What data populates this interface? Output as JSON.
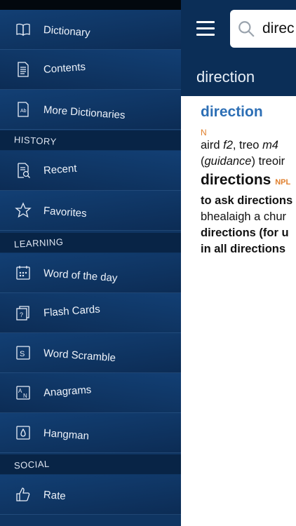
{
  "sidebar": {
    "items": [
      {
        "label": "Dictionary",
        "icon": "book-icon"
      },
      {
        "label": "Contents",
        "icon": "document-icon"
      },
      {
        "label": "More Dictionaries",
        "icon": "dictionaries-icon"
      }
    ],
    "history_header": "HISTORY",
    "history": [
      {
        "label": "Recent",
        "icon": "recent-icon"
      },
      {
        "label": "Favorites",
        "icon": "star-icon"
      }
    ],
    "learning_header": "LEARNING",
    "learning": [
      {
        "label": "Word of the day",
        "icon": "calendar-icon"
      },
      {
        "label": "Flash Cards",
        "icon": "flash-cards-icon"
      },
      {
        "label": "Word Scramble",
        "icon": "scramble-icon"
      },
      {
        "label": "Anagrams",
        "icon": "anagrams-icon"
      },
      {
        "label": "Hangman",
        "icon": "hangman-icon"
      }
    ],
    "social_header": "SOCIAL",
    "social": [
      {
        "label": "Rate",
        "icon": "thumbs-up-icon"
      }
    ]
  },
  "search": {
    "value": "direc"
  },
  "page_title": "direction",
  "entry": {
    "headword": "direction",
    "pos": "N",
    "line1_a": "aird ",
    "line1_b": "f2",
    "line1_c": ", treo ",
    "line1_d": "m4",
    "line2_a": "(",
    "line2_b": "guidance",
    "line2_c": ") treoir",
    "plural": "directions",
    "plural_tag": "NPL",
    "ex1": "to ask directions",
    "ex1_trans": "bhealaigh a chur",
    "ex2": "directions (for u",
    "ex3": "in all directions"
  },
  "colors": {
    "sidebar": "#0f3562",
    "topbar": "#0b2e57",
    "headword": "#2d6fb5",
    "pos": "#e07f2c"
  }
}
